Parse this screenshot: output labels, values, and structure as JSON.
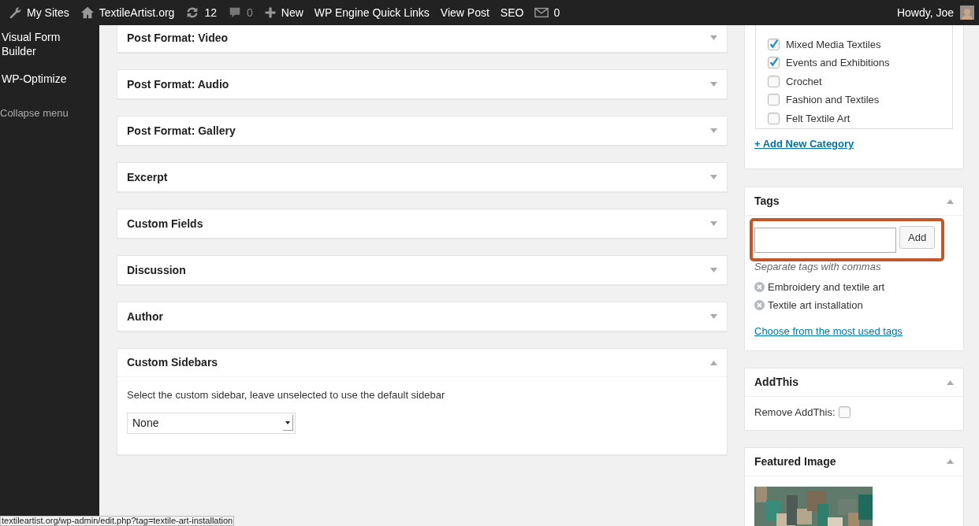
{
  "admin_bar": {
    "items": [
      {
        "kind": "wrench",
        "label": "My Sites"
      },
      {
        "kind": "home",
        "label": "TextileArtist.org"
      },
      {
        "kind": "updates",
        "label": "12"
      },
      {
        "kind": "comments",
        "label": "0",
        "dimmed": true
      },
      {
        "kind": "plus",
        "label": "New"
      },
      {
        "kind": "text",
        "label": "WP Engine Quick Links"
      },
      {
        "kind": "text",
        "label": "View Post"
      },
      {
        "kind": "text",
        "label": "SEO"
      },
      {
        "kind": "mail",
        "label": "0"
      }
    ],
    "account": "Howdy, Joe"
  },
  "sidebar": {
    "items": [
      "Visual Form Builder",
      "WP-Optimize"
    ],
    "collapse": "Collapse menu"
  },
  "postboxes": [
    {
      "title": "Post Format: Video",
      "expanded": false
    },
    {
      "title": "Post Format: Audio",
      "expanded": false
    },
    {
      "title": "Post Format: Gallery",
      "expanded": false
    },
    {
      "title": "Excerpt",
      "expanded": false
    },
    {
      "title": "Custom Fields",
      "expanded": false
    },
    {
      "title": "Discussion",
      "expanded": false
    },
    {
      "title": "Author",
      "expanded": false
    },
    {
      "title": "Custom Sidebars",
      "expanded": true,
      "description": "Select the custom sidebar, leave unselected to use the default sidebar",
      "select_value": "None"
    }
  ],
  "categories": {
    "items": [
      {
        "label": "Mixed Media Textiles",
        "checked": true
      },
      {
        "label": "Events and Exhibitions",
        "checked": true
      },
      {
        "label": "Crochet",
        "checked": false
      },
      {
        "label": "Fashion and Textiles",
        "checked": false
      },
      {
        "label": "Felt Textile Art",
        "checked": false
      }
    ],
    "add_link": "+ Add New Category"
  },
  "tags": {
    "title": "Tags",
    "expanded": true,
    "highlighted": true,
    "button": "Add",
    "hint": "Separate tags with commas",
    "items": [
      "Embroidery and textile art",
      "Textile art installation"
    ],
    "link": "Choose from the most used tags"
  },
  "addthis": {
    "title": "AddThis",
    "expanded": true,
    "label": "Remove AddThis:",
    "checked": false
  },
  "featured_image": {
    "title": "Featured Image",
    "expanded": true
  },
  "status_url": "textileartist.org/wp-admin/edit.php?tag=textile-art-installation"
}
